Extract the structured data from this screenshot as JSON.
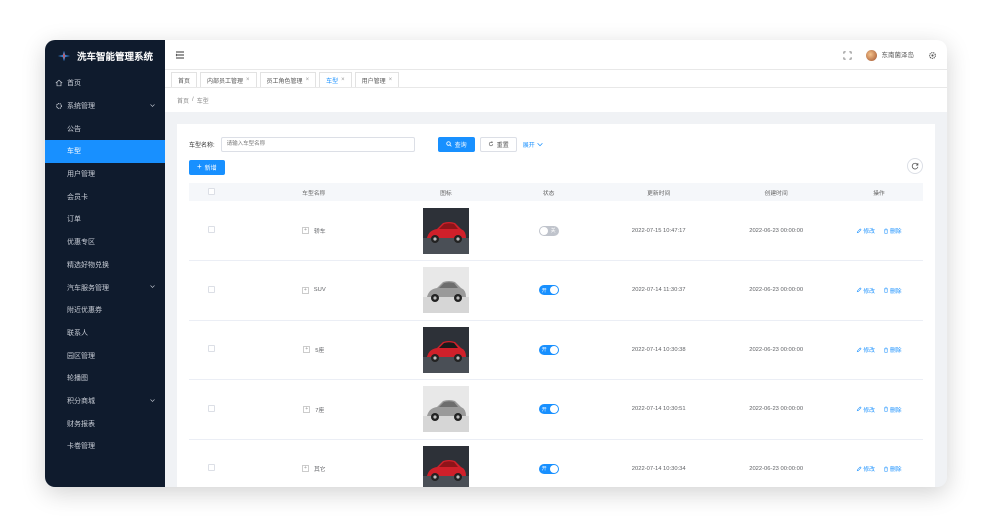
{
  "app": {
    "title": "洗车智能管理系统"
  },
  "sidebar": {
    "items": [
      {
        "label": "首页",
        "level": 0
      },
      {
        "label": "系统管理",
        "level": 0,
        "expandable": true
      },
      {
        "label": "公告",
        "level": 1
      },
      {
        "label": "车型",
        "level": 1,
        "active": true
      },
      {
        "label": "用户管理",
        "level": 1
      },
      {
        "label": "会员卡",
        "level": 1
      },
      {
        "label": "订单",
        "level": 1
      },
      {
        "label": "优惠专区",
        "level": 1
      },
      {
        "label": "精选好物兑换",
        "level": 1
      },
      {
        "label": "汽车服务管理",
        "level": 1,
        "expandable": true
      },
      {
        "label": "附近优惠券",
        "level": 1
      },
      {
        "label": "联系人",
        "level": 1
      },
      {
        "label": "园区管理",
        "level": 1
      },
      {
        "label": "轮播图",
        "level": 1
      },
      {
        "label": "积分商城",
        "level": 1,
        "expandable": true
      },
      {
        "label": "财务报表",
        "level": 1
      },
      {
        "label": "卡卷管理",
        "level": 1
      }
    ]
  },
  "topbar": {
    "username": "东南菌泽岛"
  },
  "tabs": [
    {
      "label": "首页",
      "closable": false
    },
    {
      "label": "内部员工管理",
      "closable": true
    },
    {
      "label": "员工角色管理",
      "closable": true
    },
    {
      "label": "车型",
      "closable": true,
      "active": true
    },
    {
      "label": "用户管理",
      "closable": true
    }
  ],
  "breadcrumb": {
    "home": "首页",
    "sep": "/",
    "current": "车型"
  },
  "search": {
    "label": "车型名称:",
    "placeholder": "请输入车型名称",
    "query_label": "查询",
    "reset_label": "重置",
    "expand_label": "展开"
  },
  "toolbar": {
    "add_label": "新增"
  },
  "table": {
    "headers": [
      "",
      "车型名称",
      "图标",
      "状态",
      "更新时间",
      "创建时间",
      "操作"
    ],
    "edit_label": "修改",
    "delete_label": "删除",
    "rows": [
      {
        "name": "轿车",
        "status": "关",
        "status_on": false,
        "updated": "2022-07-15 10:47:17",
        "created": "2022-06-23 00:00:00",
        "car": "red"
      },
      {
        "name": "SUV",
        "status": "开",
        "status_on": true,
        "updated": "2022-07-14 11:30:37",
        "created": "2022-06-23 00:00:00",
        "car": "silver"
      },
      {
        "name": "5座",
        "status": "开",
        "status_on": true,
        "updated": "2022-07-14 10:30:38",
        "created": "2022-06-23 00:00:00",
        "car": "redblack"
      },
      {
        "name": "7座",
        "status": "开",
        "status_on": true,
        "updated": "2022-07-14 10:30:51",
        "created": "2022-06-23 00:00:00",
        "car": "silver"
      },
      {
        "name": "其它",
        "status": "开",
        "status_on": true,
        "updated": "2022-07-14 10:30:34",
        "created": "2022-06-23 00:00:00",
        "car": "red"
      }
    ]
  },
  "colors": {
    "primary": "#1890ff",
    "sidebar_bg": "#0f1b2d",
    "page_bg": "#f0f2f5"
  }
}
